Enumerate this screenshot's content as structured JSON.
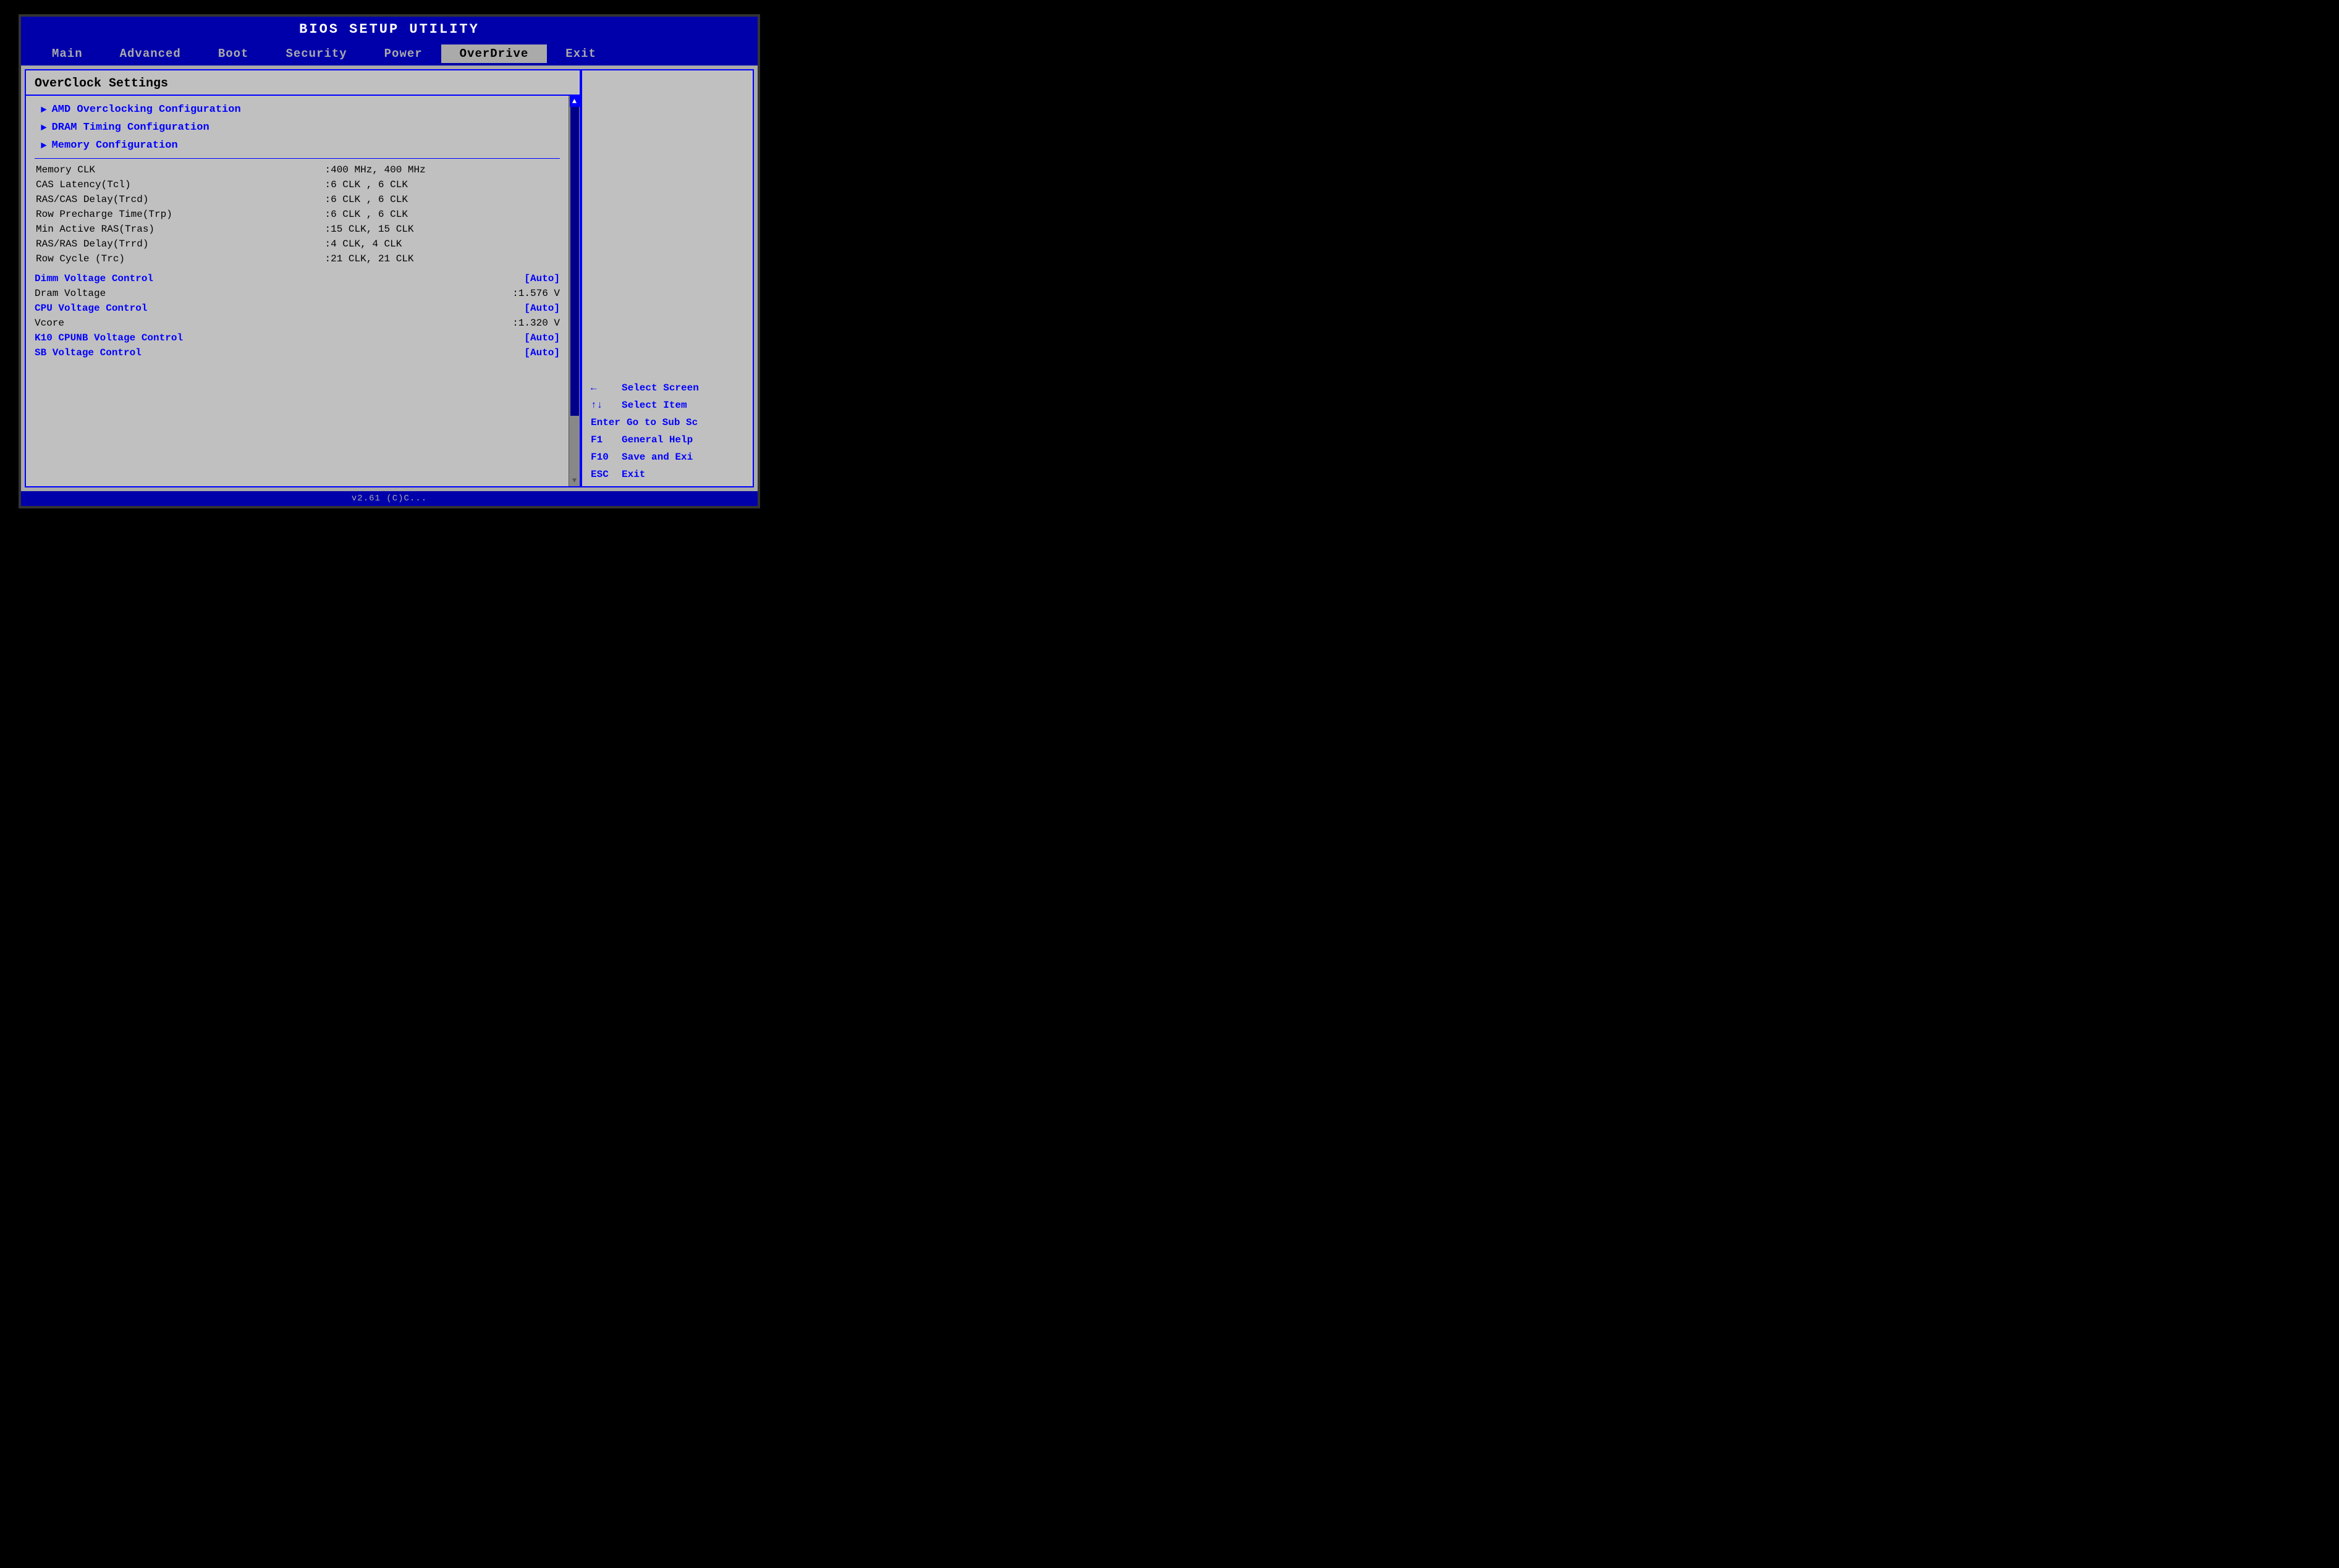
{
  "bios": {
    "title": "BIOS SETUP UTILITY",
    "menu_items": [
      {
        "label": "Main",
        "active": false
      },
      {
        "label": "Advanced",
        "active": false
      },
      {
        "label": "Boot",
        "active": false
      },
      {
        "label": "Security",
        "active": false
      },
      {
        "label": "Power",
        "active": false
      },
      {
        "label": "OverDrive",
        "active": true
      },
      {
        "label": "Exit",
        "active": false
      }
    ],
    "panel_title": "OverClock Settings",
    "sub_menus": [
      {
        "label": "AMD Overclocking Configuration"
      },
      {
        "label": "DRAM Timing Configuration"
      },
      {
        "label": "Memory Configuration"
      }
    ],
    "info_rows": [
      {
        "label": "Memory CLK",
        "value": ":400 MHz, 400 MHz"
      },
      {
        "label": "CAS Latency(Tcl)",
        "value": ":6 CLK , 6 CLK"
      },
      {
        "label": "RAS/CAS Delay(Trcd)",
        "value": ":6 CLK , 6 CLK"
      },
      {
        "label": "Row Precharge Time(Trp)",
        "value": ":6 CLK , 6 CLK"
      },
      {
        "label": "Min Active RAS(Tras)",
        "value": ":15 CLK, 15 CLK"
      },
      {
        "label": "RAS/RAS Delay(Trrd)",
        "value": ":4 CLK, 4 CLK"
      },
      {
        "label": "Row Cycle (Trc)",
        "value": ":21 CLK, 21 CLK"
      }
    ],
    "voltage_rows": [
      {
        "label": "Dimm Voltage Control",
        "value": "[Auto]",
        "blue": true
      },
      {
        "label": "Dram Voltage",
        "value": ":1.576 V",
        "blue": false
      },
      {
        "label": "CPU Voltage Control",
        "value": "[Auto]",
        "blue": true
      },
      {
        "label": "Vcore",
        "value": ":1.320 V",
        "blue": false
      },
      {
        "label": "K10 CPUNB Voltage Control",
        "value": "[Auto]",
        "blue": true
      },
      {
        "label": "SB Voltage Control",
        "value": "[Auto]",
        "blue": true
      }
    ],
    "help": [
      {
        "key": "←",
        "desc": "Select Screen"
      },
      {
        "key": "↑↓",
        "desc": "Select Item"
      },
      {
        "key": "Enter",
        "desc": "Go to Sub Sc"
      },
      {
        "key": "F1",
        "desc": "General Help"
      },
      {
        "key": "F10",
        "desc": "Save and Exi"
      },
      {
        "key": "ESC",
        "desc": "Exit"
      }
    ],
    "bottom_bar": "v2.61 (C)C..."
  }
}
